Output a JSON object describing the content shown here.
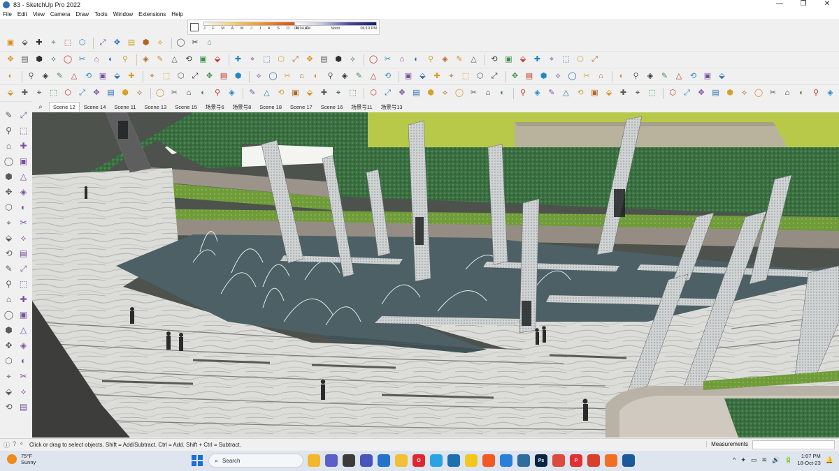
{
  "window": {
    "title": "83 - SketchUp Pro 2022",
    "controls": [
      "—",
      "❐",
      "✕"
    ]
  },
  "menu": [
    "File",
    "Edit",
    "View",
    "Camera",
    "Draw",
    "Tools",
    "Window",
    "Extensions",
    "Help"
  ],
  "shadows": {
    "months": [
      "J",
      "F",
      "M",
      "A",
      "M",
      "J",
      "J",
      "A",
      "S",
      "O",
      "N",
      "D"
    ],
    "times": [
      "06:04 AM",
      "Noon",
      "06:10 PM"
    ]
  },
  "scenes": {
    "search_icon": "⌕",
    "tabs": [
      "Scene 12",
      "Scene 14",
      "Scene 11",
      "Scene 13",
      "Scene 15",
      "场景号6",
      "场景号8",
      "Scene 18",
      "Scene 17",
      "Scene 16",
      "场景号11",
      "场景号13"
    ],
    "active_index": 0
  },
  "status": {
    "message": "Click or drag to select objects. Shift = Add/Subtract. Ctrl = Add. Shift + Ctrl = Subtract.",
    "measurements_label": "Measurements",
    "icons": [
      "ⓘ",
      "?",
      "⚬"
    ]
  },
  "taskbar": {
    "temperature": "75°F",
    "weather": "Sunny",
    "search_placeholder": "Search",
    "time": "1:07 PM",
    "date": "18-Oct-23",
    "tray_icons": [
      "^",
      "✦",
      "▭",
      "≋",
      "🔊",
      "🔋",
      "🔔"
    ],
    "apps": [
      {
        "name": "file-explorer",
        "color": "#f3b82a",
        "glyph": ""
      },
      {
        "name": "chat",
        "color": "#5b5fc7",
        "glyph": ""
      },
      {
        "name": "task-view",
        "color": "#3b3b3b",
        "glyph": ""
      },
      {
        "name": "teams",
        "color": "#4b53bc",
        "glyph": ""
      },
      {
        "name": "calendar",
        "color": "#2672c8",
        "glyph": ""
      },
      {
        "name": "folder",
        "color": "#f2c037",
        "glyph": ""
      },
      {
        "name": "opera",
        "color": "#e0262e",
        "glyph": "O"
      },
      {
        "name": "telegram",
        "color": "#2aa3e0",
        "glyph": ""
      },
      {
        "name": "sketchup",
        "color": "#1d6fb0",
        "glyph": ""
      },
      {
        "name": "notes",
        "color": "#f2c81f",
        "glyph": ""
      },
      {
        "name": "brave",
        "color": "#f25a22",
        "glyph": ""
      },
      {
        "name": "mail",
        "color": "#2a7fd8",
        "glyph": ""
      },
      {
        "name": "viewer",
        "color": "#2d6e9e",
        "glyph": ""
      },
      {
        "name": "photoshop",
        "color": "#0a2542",
        "glyph": "Ps"
      },
      {
        "name": "chrome",
        "color": "#dd4b3a",
        "glyph": ""
      },
      {
        "name": "pinterest",
        "color": "#e32f2f",
        "glyph": "P"
      },
      {
        "name": "ms-office",
        "color": "#d8402c",
        "glyph": ""
      },
      {
        "name": "soundcloud",
        "color": "#f26f21",
        "glyph": ""
      },
      {
        "name": "sketchup-active",
        "color": "#1a5a9a",
        "glyph": ""
      }
    ]
  },
  "colors": {
    "water": "#4a5f64",
    "paving": "#d8d8d4",
    "hedge": "#3f7a45",
    "lawn": "#a8c347",
    "accent": "#2d6fb3"
  }
}
